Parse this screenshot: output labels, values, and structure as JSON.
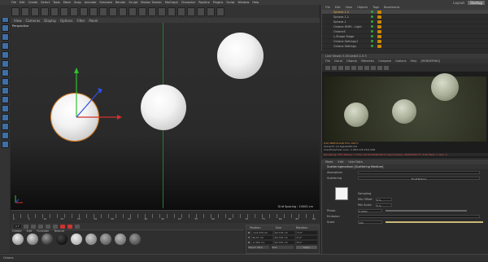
{
  "menubar": {
    "items": [
      "File",
      "Edit",
      "Create",
      "Select",
      "Tools",
      "Mesh",
      "Snap",
      "Animate",
      "Simulate",
      "Render",
      "Sculpt",
      "Motion Tracker",
      "MoGraph",
      "Character",
      "Pipeline",
      "Plugins",
      "Script",
      "Window",
      "Help"
    ],
    "layout_label": "Layout:",
    "layout_value": "Startup"
  },
  "viewport": {
    "menu": [
      "View",
      "Cameras",
      "Display",
      "Options",
      "Filter",
      "Panel"
    ],
    "label": "Perspective",
    "grid_spacing": "Grid Spacing : 10000 cm"
  },
  "timeline": {
    "ticks": [
      "0",
      "5",
      "10",
      "15",
      "20",
      "25",
      "30",
      "35",
      "40",
      "45",
      "50",
      "55",
      "60",
      "65",
      "70",
      "75",
      "80",
      "85",
      "90"
    ],
    "frame_start": "0 F",
    "frame_end": "90 F"
  },
  "materials": {
    "menu": [
      "Create",
      "Edit",
      "Function",
      "Texture"
    ]
  },
  "coordinates": {
    "headers": [
      "Position",
      "Size",
      "Rotation"
    ],
    "rows": [
      {
        "axis": "X",
        "pos": "-114.379 cm",
        "size": "24.715 cm",
        "rot": "H 0°"
      },
      {
        "axis": "Y",
        "pos": "90.57 cm",
        "size": "24.715 cm",
        "rot": "P 0°"
      },
      {
        "axis": "Z",
        "pos": "-0.295 cm",
        "size": "24.715 cm",
        "rot": "B 0°"
      }
    ],
    "mode": "Object (Rel)",
    "size_mode": "Size",
    "apply": "Apply"
  },
  "object_manager": {
    "menu": [
      "File",
      "Edit",
      "View",
      "Objects",
      "Tags",
      "Bookmarks"
    ],
    "objects": [
      {
        "name": "Sphere.1.2",
        "selected": true
      },
      {
        "name": "Sphere.1.1",
        "selected": false
      },
      {
        "name": "Sphere.1",
        "selected": false
      },
      {
        "name": "Octane HDRI - Light",
        "selected": false
      },
      {
        "name": "OctaneS",
        "selected": false
      },
      {
        "name": "L-Shape Stage",
        "selected": false
      },
      {
        "name": "Octane Settings1",
        "selected": false
      },
      {
        "name": "Octane Settings",
        "selected": false
      }
    ]
  },
  "live_viewer": {
    "title": "Live Viewer 3.05-beta3-1.5.3",
    "menu": [
      "File",
      "Cloud",
      "Objects",
      "Materials",
      "Compare",
      "Options",
      "Help",
      "[RENDERING]"
    ],
    "status_line": "GTX 980TI/11GB   53%   100°C",
    "info": [
      "ShadyTX 1/3   RgbGGMD 0/0",
      "Used/free/total vram: 2.98/3.3/6.25/6.0GB",
      "Rendering: 50%    Ms/sec: 1    Time: 00:00:00/00:00:21    Spp/maxspp: 4696/5000    Tri: 0/3k    Mesh: 1    Hair: 0"
    ]
  },
  "attribute_manager": {
    "menu": [
      "Mode",
      "Edit",
      "User Data"
    ],
    "title": "Scatteringmedium [Scattering Medium]",
    "rows": [
      {
        "label": "Absorption",
        "value": ""
      },
      {
        "label": "Scattering",
        "value": "FloatTexture"
      },
      {
        "label": "Sampling",
        "value": ""
      },
      {
        "label": "Mix Offset",
        "value": "0 %"
      },
      {
        "label": "Mix Scale",
        "value": "0 %"
      },
      {
        "label": "Phase",
        "value": "0.0000"
      },
      {
        "label": "Emission",
        "value": ""
      },
      {
        "label": "Scale",
        "value": "100"
      }
    ]
  },
  "statusbar": {
    "text": "Octane"
  },
  "colors": {
    "accent": "#f0b040",
    "selection": "#e08020",
    "axis_x": "#d03030",
    "axis_y": "#30c030",
    "axis_z": "#3050e0"
  }
}
